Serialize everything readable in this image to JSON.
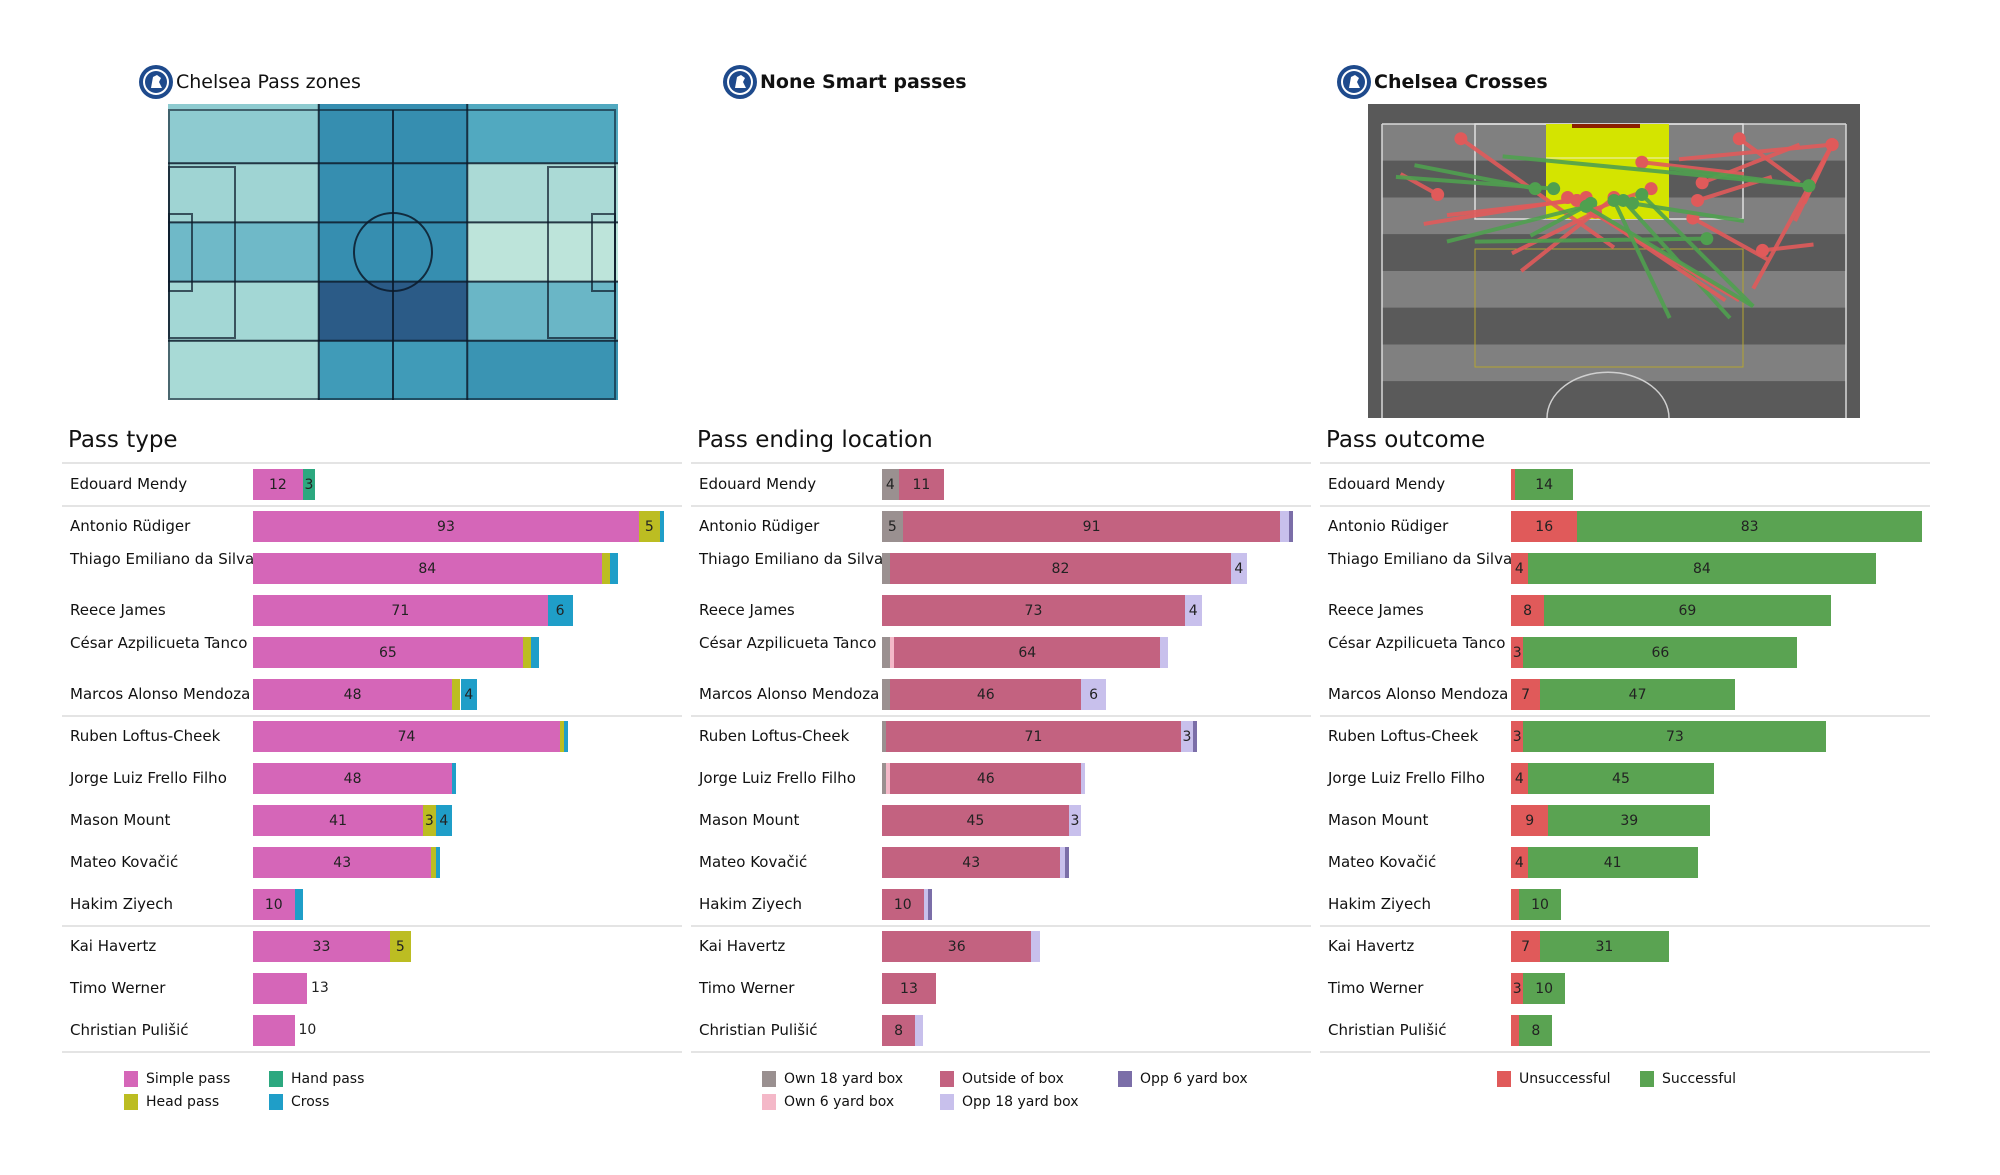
{
  "panels": {
    "pass_zones": {
      "title": "Chelsea Pass zones",
      "crest_icon": "chelsea-crest-icon"
    },
    "smart_passes": {
      "title": "None Smart passes",
      "crest_icon": "chelsea-crest-icon"
    },
    "crosses": {
      "title": "Chelsea Crosses",
      "crest_icon": "chelsea-crest-icon"
    }
  },
  "chart_data": [
    {
      "type": "heatmap",
      "title": "Chelsea Pass zones",
      "description": "Pitch divided into zones; darker blue = more passes",
      "columns": 4,
      "rows": 5,
      "column_bounds_fraction": [
        0,
        0.335,
        0.5,
        0.665,
        1
      ],
      "row_fraction_note": "rows top to bottom",
      "colors": [
        [
          "#8ecbd0",
          "#368eb0",
          "#368eb0",
          "#51a9c0"
        ],
        [
          "#9fd4d3",
          "#368eb0",
          "#368eb0",
          "#abdad6"
        ],
        [
          "#6fb9c8",
          "#368eb0",
          "#368eb0",
          "#bde4da"
        ],
        [
          "#a3d7d5",
          "#2b5b87",
          "#2b5b87",
          "#6ab6c6"
        ],
        [
          "#a8dad6",
          "#409bb8",
          "#409bb8",
          "#3a94b3"
        ]
      ],
      "intensity": [
        [
          0.35,
          0.8,
          0.8,
          0.6
        ],
        [
          0.3,
          0.8,
          0.8,
          0.25
        ],
        [
          0.45,
          0.8,
          0.8,
          0.15
        ],
        [
          0.28,
          1.0,
          1.0,
          0.47
        ],
        [
          0.25,
          0.72,
          0.72,
          0.78
        ]
      ]
    },
    {
      "type": "scatter",
      "title": "Chelsea Crosses",
      "description": "Cross start-end lines on half pitch; red = unsuccessful, green = successful",
      "colors": {
        "unsuccessful": "#e05a5a",
        "successful": "#4fa04f"
      },
      "crosses": [
        {
          "x1": 0.17,
          "y1": 0.05,
          "x2": 0.5,
          "y2": 0.42,
          "outcome": "unsuccessful"
        },
        {
          "x1": 0.12,
          "y1": 0.24,
          "x2": 0.04,
          "y2": 0.17,
          "outcome": "unsuccessful"
        },
        {
          "x1": 0.33,
          "y1": 0.22,
          "x2": 0.07,
          "y2": 0.14,
          "outcome": "successful"
        },
        {
          "x1": 0.37,
          "y1": 0.22,
          "x2": 0.03,
          "y2": 0.18,
          "outcome": "successful"
        },
        {
          "x1": 0.42,
          "y1": 0.26,
          "x2": 0.14,
          "y2": 0.31,
          "outcome": "unsuccessful"
        },
        {
          "x1": 0.44,
          "y1": 0.25,
          "x2": 0.09,
          "y2": 0.34,
          "outcome": "unsuccessful"
        },
        {
          "x1": 0.5,
          "y1": 0.25,
          "x2": 0.3,
          "y2": 0.5,
          "outcome": "unsuccessful"
        },
        {
          "x1": 0.46,
          "y1": 0.3,
          "x2": 0.28,
          "y2": 0.44,
          "outcome": "unsuccessful"
        },
        {
          "x1": 0.45,
          "y1": 0.27,
          "x2": 0.32,
          "y2": 0.38,
          "outcome": "successful"
        },
        {
          "x1": 0.44,
          "y1": 0.28,
          "x2": 0.14,
          "y2": 0.4,
          "outcome": "successful"
        },
        {
          "x1": 0.56,
          "y1": 0.13,
          "x2": 0.78,
          "y2": 0.17,
          "outcome": "unsuccessful"
        },
        {
          "x1": 0.58,
          "y1": 0.22,
          "x2": 0.44,
          "y2": 0.3,
          "outcome": "unsuccessful"
        },
        {
          "x1": 0.69,
          "y1": 0.2,
          "x2": 0.9,
          "y2": 0.07,
          "outcome": "unsuccessful"
        },
        {
          "x1": 0.68,
          "y1": 0.26,
          "x2": 0.84,
          "y2": 0.18,
          "outcome": "unsuccessful"
        },
        {
          "x1": 0.67,
          "y1": 0.32,
          "x2": 0.83,
          "y2": 0.46,
          "outcome": "unsuccessful"
        },
        {
          "x1": 0.7,
          "y1": 0.39,
          "x2": 0.2,
          "y2": 0.4,
          "outcome": "successful"
        },
        {
          "x1": 0.77,
          "y1": 0.05,
          "x2": 0.9,
          "y2": 0.2,
          "outcome": "unsuccessful"
        },
        {
          "x1": 0.82,
          "y1": 0.43,
          "x2": 0.93,
          "y2": 0.41,
          "outcome": "unsuccessful"
        },
        {
          "x1": 0.97,
          "y1": 0.07,
          "x2": 0.64,
          "y2": 0.12,
          "outcome": "unsuccessful"
        },
        {
          "x1": 0.97,
          "y1": 0.07,
          "x2": 0.8,
          "y2": 0.56,
          "outcome": "unsuccessful"
        },
        {
          "x1": 0.97,
          "y1": 0.07,
          "x2": 0.89,
          "y2": 0.33,
          "outcome": "unsuccessful"
        },
        {
          "x1": 0.97,
          "y1": 0.07,
          "x2": 0.91,
          "y2": 0.27,
          "outcome": "unsuccessful"
        },
        {
          "x1": 0.92,
          "y1": 0.21,
          "x2": 0.26,
          "y2": 0.11,
          "outcome": "successful"
        },
        {
          "x1": 0.92,
          "y1": 0.21,
          "x2": 0.62,
          "y2": 0.15,
          "outcome": "successful"
        },
        {
          "x1": 0.56,
          "y1": 0.24,
          "x2": 0.8,
          "y2": 0.62,
          "outcome": "successful"
        },
        {
          "x1": 0.52,
          "y1": 0.26,
          "x2": 0.75,
          "y2": 0.66,
          "outcome": "successful"
        },
        {
          "x1": 0.42,
          "y1": 0.26,
          "x2": 0.74,
          "y2": 0.6,
          "outcome": "unsuccessful"
        },
        {
          "x1": 0.4,
          "y1": 0.25,
          "x2": 0.77,
          "y2": 0.6,
          "outcome": "unsuccessful"
        },
        {
          "x1": 0.44,
          "y1": 0.28,
          "x2": 0.8,
          "y2": 0.62,
          "outcome": "successful"
        },
        {
          "x1": 0.54,
          "y1": 0.27,
          "x2": 0.78,
          "y2": 0.33,
          "outcome": "successful"
        },
        {
          "x1": 0.5,
          "y1": 0.26,
          "x2": 0.62,
          "y2": 0.66,
          "outcome": "successful"
        }
      ]
    },
    {
      "type": "bar",
      "stacked": true,
      "orientation": "horizontal",
      "title": "Pass type",
      "categories": [
        "Edouard Mendy",
        "Antonio Rüdiger",
        "Thiago Emiliano da Silva",
        "Reece James",
        "César Azpilicueta Tanco",
        "Marcos  Alonso Mendoza",
        "Ruben Loftus-Cheek",
        "Jorge Luiz Frello Filho",
        "Mason Mount",
        "Mateo Kovačić",
        "Hakim Ziyech",
        "Kai Havertz",
        "Timo Werner",
        "Christian Pulišić"
      ],
      "series": [
        {
          "name": "Simple pass",
          "color": "#d566b8",
          "values": [
            12,
            93,
            84,
            71,
            65,
            48,
            74,
            48,
            41,
            43,
            10,
            33,
            13,
            10
          ]
        },
        {
          "name": "Head pass",
          "color": "#bcbd22",
          "values": [
            0,
            5,
            2,
            0,
            2,
            2,
            1,
            0,
            3,
            1,
            0,
            5,
            0,
            0
          ]
        },
        {
          "name": "Hand pass",
          "color": "#2ca87f",
          "values": [
            3,
            0,
            0,
            0,
            0,
            0,
            0,
            0,
            0,
            0,
            0,
            0,
            0,
            0
          ]
        },
        {
          "name": "Cross",
          "color": "#1f9ec8",
          "values": [
            0,
            1,
            2,
            6,
            2,
            4,
            1,
            1,
            4,
            1,
            2,
            0,
            0,
            0
          ]
        }
      ],
      "legend": [
        "Simple pass",
        "Head pass",
        "Hand pass",
        "Cross"
      ],
      "legend_position": "bottom"
    },
    {
      "type": "bar",
      "stacked": true,
      "orientation": "horizontal",
      "title": "Pass ending location",
      "categories": [
        "Edouard Mendy",
        "Antonio Rüdiger",
        "Thiago Emiliano da Silva",
        "Reece James",
        "César Azpilicueta Tanco",
        "Marcos  Alonso Mendoza",
        "Ruben Loftus-Cheek",
        "Jorge Luiz Frello Filho",
        "Mason Mount",
        "Mateo Kovačić",
        "Hakim Ziyech",
        "Kai Havertz",
        "Timo Werner",
        "Christian Pulišić"
      ],
      "series": [
        {
          "name": "Own 18 yard box",
          "color": "#9a9090",
          "values": [
            4,
            5,
            2,
            0,
            2,
            2,
            1,
            1,
            0,
            0,
            0,
            0,
            0,
            0
          ]
        },
        {
          "name": "Own 6 yard box",
          "color": "#f4b8c8",
          "values": [
            0,
            0,
            0,
            0,
            1,
            0,
            0,
            1,
            0,
            0,
            0,
            0,
            0,
            0
          ]
        },
        {
          "name": "Outside of box",
          "color": "#c36280",
          "values": [
            11,
            91,
            82,
            73,
            64,
            46,
            71,
            46,
            45,
            43,
            10,
            36,
            13,
            8
          ]
        },
        {
          "name": "Opp 18 yard box",
          "color": "#c8c0ec",
          "values": [
            0,
            2,
            4,
            4,
            2,
            6,
            3,
            1,
            3,
            1,
            1,
            2,
            0,
            2
          ]
        },
        {
          "name": "Opp 6 yard box",
          "color": "#7b6ea8",
          "values": [
            0,
            1,
            0,
            0,
            0,
            0,
            1,
            0,
            0,
            1,
            1,
            0,
            0,
            0
          ]
        }
      ],
      "legend": [
        "Own 18 yard box",
        "Own 6 yard box",
        "Outside of box",
        "Opp 18 yard box",
        "Opp 6 yard box"
      ],
      "legend_position": "bottom"
    },
    {
      "type": "bar",
      "stacked": true,
      "orientation": "horizontal",
      "title": "Pass outcome",
      "categories": [
        "Edouard Mendy",
        "Antonio Rüdiger",
        "Thiago Emiliano da Silva",
        "Reece James",
        "César Azpilicueta Tanco",
        "Marcos  Alonso Mendoza",
        "Ruben Loftus-Cheek",
        "Jorge Luiz Frello Filho",
        "Mason Mount",
        "Mateo Kovačić",
        "Hakim Ziyech",
        "Kai Havertz",
        "Timo Werner",
        "Christian Pulišić"
      ],
      "series": [
        {
          "name": "Unsuccessful",
          "color": "#e05a5a",
          "values": [
            1,
            16,
            4,
            8,
            3,
            7,
            3,
            4,
            9,
            4,
            2,
            7,
            3,
            2
          ]
        },
        {
          "name": "Successful",
          "color": "#5aa352",
          "values": [
            14,
            83,
            84,
            69,
            66,
            47,
            73,
            45,
            39,
            41,
            10,
            31,
            10,
            8
          ]
        }
      ],
      "legend": [
        "Unsuccessful",
        "Successful"
      ],
      "legend_position": "bottom"
    }
  ],
  "groups": [
    [
      0
    ],
    [
      1,
      2,
      3,
      4,
      5
    ],
    [
      6,
      7,
      8,
      9,
      10
    ],
    [
      11,
      12,
      13
    ]
  ],
  "label_threshold": 2
}
